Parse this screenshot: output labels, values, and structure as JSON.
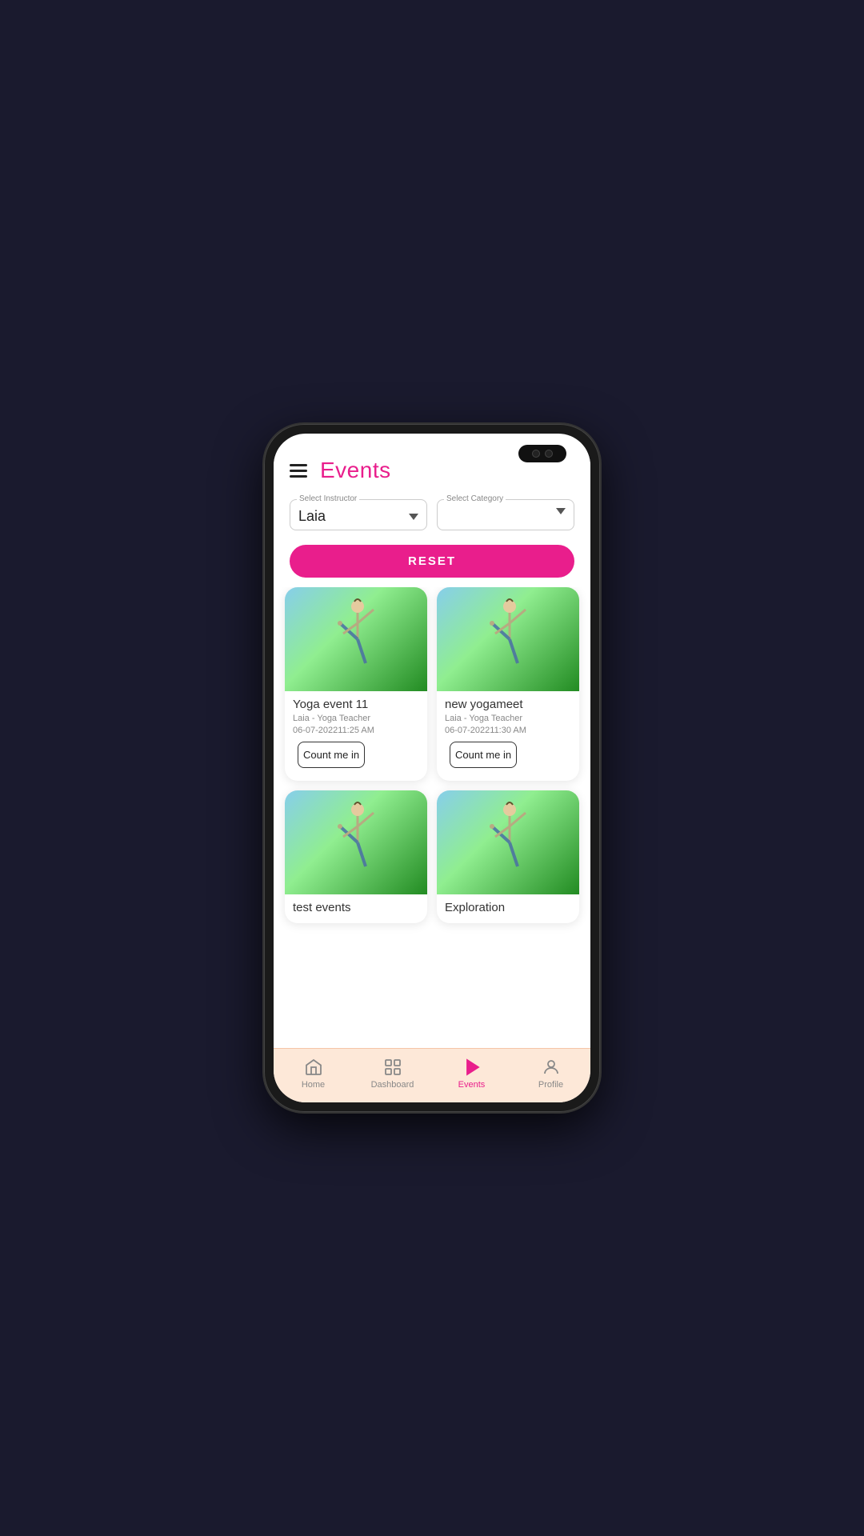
{
  "header": {
    "title": "Events"
  },
  "filters": {
    "instructor": {
      "label": "Select Instructor",
      "value": "Laia"
    },
    "category": {
      "label": "Select Category",
      "value": ""
    }
  },
  "reset_button": "RESET",
  "events": [
    {
      "id": 1,
      "name": "Yoga event 11",
      "instructor": "Laia - Yoga Teacher",
      "date": "06-07-202211:25 AM",
      "button": "Count me in"
    },
    {
      "id": 2,
      "name": "new yogameet",
      "instructor": "Laia - Yoga Teacher",
      "date": "06-07-202211:30 AM",
      "button": "Count me in"
    },
    {
      "id": 3,
      "name": "test events",
      "instructor": "",
      "date": "",
      "button": ""
    },
    {
      "id": 4,
      "name": "Exploration",
      "instructor": "",
      "date": "",
      "button": ""
    }
  ],
  "bottom_nav": {
    "items": [
      {
        "label": "Home",
        "icon": "home-icon",
        "active": false
      },
      {
        "label": "Dashboard",
        "icon": "dashboard-icon",
        "active": false
      },
      {
        "label": "Events",
        "icon": "events-icon",
        "active": true
      },
      {
        "label": "Profile",
        "icon": "profile-icon",
        "active": false
      }
    ]
  },
  "colors": {
    "accent": "#e91e8c",
    "nav_bg": "#fde8d8"
  }
}
